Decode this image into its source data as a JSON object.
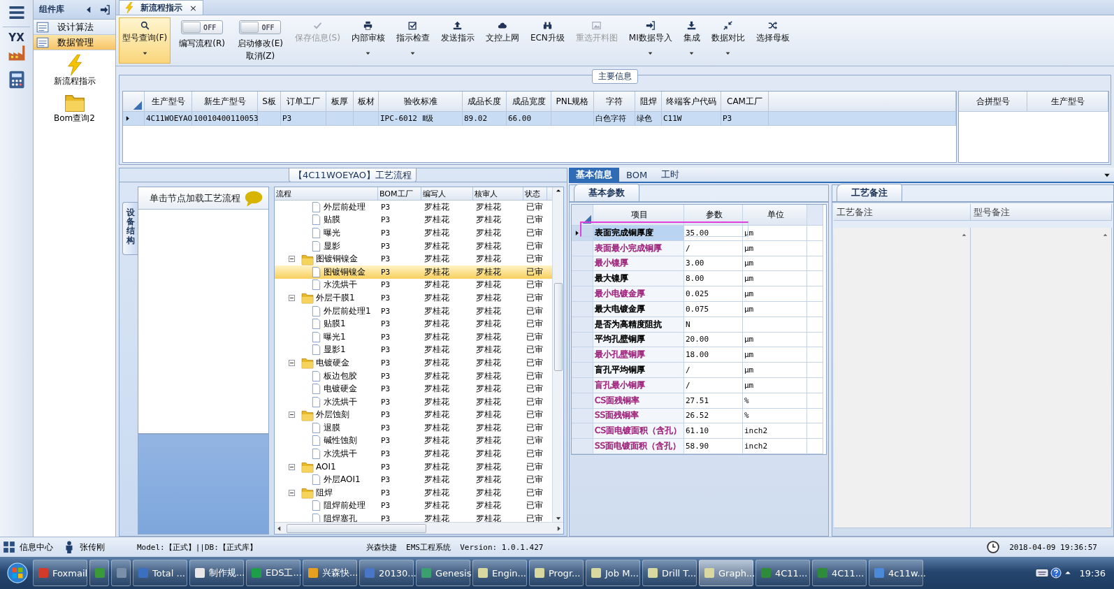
{
  "rail": {
    "items": [
      {
        "kind": "menu"
      },
      {
        "kind": "logo",
        "text": "YX"
      },
      {
        "kind": "calc"
      }
    ]
  },
  "sidebar": {
    "title": "组件库",
    "items": [
      {
        "label": "设计算法",
        "selected": false
      },
      {
        "label": "数据管理",
        "selected": true
      }
    ],
    "shortcuts": [
      {
        "label": "新流程指示"
      },
      {
        "label": "Bom查询2"
      }
    ]
  },
  "document_tabs": [
    {
      "label": "新流程指示",
      "selected": true,
      "close": "×"
    }
  ],
  "toolbar": [
    {
      "kind": "button",
      "label": "型号查询(F)",
      "selected": true,
      "disabled": false,
      "dropdown": true
    },
    {
      "kind": "toggle",
      "switch_text": "OFF",
      "on": false,
      "label": "编写流程(R)"
    },
    {
      "kind": "toggle",
      "switch_text": "OFF",
      "on": false,
      "label": "启动修改(E)",
      "label_2": "取消(Z)"
    },
    {
      "kind": "button",
      "label": "保存信息(S)",
      "selected": false,
      "disabled": true,
      "dropdown": false
    },
    {
      "kind": "button",
      "label": "内部审核",
      "selected": false,
      "disabled": false,
      "dropdown": true
    },
    {
      "kind": "button",
      "label": "指示检查",
      "selected": false,
      "disabled": false,
      "dropdown": true
    },
    {
      "kind": "button",
      "label": "发送指示",
      "selected": false,
      "disabled": false,
      "dropdown": false
    },
    {
      "kind": "button",
      "label": "文控上网",
      "selected": false,
      "disabled": false,
      "dropdown": false
    },
    {
      "kind": "button",
      "label": "ECN升级",
      "selected": false,
      "disabled": false,
      "dropdown": false
    },
    {
      "kind": "button",
      "label": "重选开料图",
      "selected": false,
      "disabled": true,
      "dropdown": false
    },
    {
      "kind": "button",
      "label": "MI数据导入",
      "selected": false,
      "disabled": false,
      "dropdown": true
    },
    {
      "kind": "button",
      "label": "集成",
      "selected": false,
      "disabled": false,
      "dropdown": true
    },
    {
      "kind": "button",
      "label": "数据对比",
      "selected": false,
      "disabled": false,
      "dropdown": true
    },
    {
      "kind": "button",
      "label": "选择母板",
      "selected": false,
      "disabled": false,
      "dropdown": false
    }
  ],
  "main_info": {
    "title": "主要信息",
    "row_selected": true,
    "columns": [
      {
        "label": "生产型号",
        "value": "4C11WOEYAO"
      },
      {
        "label": "新生产型号",
        "value": "10010400110053"
      },
      {
        "label": "S板"
      },
      {
        "label": "订单工厂",
        "value": "P3"
      },
      {
        "label": "板厚"
      },
      {
        "label": "板材"
      },
      {
        "label": "验收标准",
        "value": "IPC-6012 Ⅱ级"
      },
      {
        "label": "成品长度",
        "value": "89.02"
      },
      {
        "label": "成品宽度",
        "value": "66.00"
      },
      {
        "label": "PNL规格"
      },
      {
        "label": "字符",
        "value": "白色字符"
      },
      {
        "label": "阻焊",
        "value": "绿色"
      },
      {
        "label": "终端客户代码",
        "value": "C11W"
      },
      {
        "label": "CAM工厂",
        "value": "P3"
      }
    ],
    "side_columns": [
      "合拼型号",
      "生产型号"
    ]
  },
  "flow": {
    "title": "【4C11WOEYAO】工艺流程",
    "side_tab": "设备结构",
    "hint": "单击节点加载工艺流程",
    "columns": [
      "流程",
      "BOM工厂",
      "编写人",
      "核审人",
      "状态"
    ],
    "continued": [
      {
        "name": "外层前处理",
        "bom_factory": "P3",
        "writer": "罗桂花",
        "reviewer": "罗桂花",
        "status": "已审",
        "selected": false
      },
      {
        "name": "贴膜",
        "bom_factory": "P3",
        "writer": "罗桂花",
        "reviewer": "罗桂花",
        "status": "已审",
        "selected": false
      },
      {
        "name": "曝光",
        "bom_factory": "P3",
        "writer": "罗桂花",
        "reviewer": "罗桂花",
        "status": "已审",
        "selected": false
      },
      {
        "name": "显影",
        "bom_factory": "P3",
        "writer": "罗桂花",
        "reviewer": "罗桂花",
        "status": "已审",
        "selected": false
      }
    ],
    "nodes": [
      {
        "name": "图镀铜镍金",
        "bom_factory": "P3",
        "writer": "罗桂花",
        "reviewer": "罗桂花",
        "status": "已审",
        "selected": false,
        "expanded": true,
        "children": [
          {
            "name": "图镀铜镍金",
            "bom_factory": "P3",
            "writer": "罗桂花",
            "reviewer": "罗桂花",
            "status": "已审",
            "selected": true
          },
          {
            "name": "水洗烘干",
            "bom_factory": "P3",
            "writer": "罗桂花",
            "reviewer": "罗桂花",
            "status": "已审",
            "selected": false
          }
        ]
      },
      {
        "name": "外层干膜1",
        "bom_factory": "P3",
        "writer": "罗桂花",
        "reviewer": "罗桂花",
        "status": "已审",
        "selected": false,
        "expanded": true,
        "children": [
          {
            "name": "外层前处理1",
            "bom_factory": "P3",
            "writer": "罗桂花",
            "reviewer": "罗桂花",
            "status": "已审",
            "selected": false
          },
          {
            "name": "贴膜1",
            "bom_factory": "P3",
            "writer": "罗桂花",
            "reviewer": "罗桂花",
            "status": "已审",
            "selected": false
          },
          {
            "name": "曝光1",
            "bom_factory": "P3",
            "writer": "罗桂花",
            "reviewer": "罗桂花",
            "status": "已审",
            "selected": false
          },
          {
            "name": "显影1",
            "bom_factory": "P3",
            "writer": "罗桂花",
            "reviewer": "罗桂花",
            "status": "已审",
            "selected": false
          }
        ]
      },
      {
        "name": "电镀硬金",
        "bom_factory": "P3",
        "writer": "罗桂花",
        "reviewer": "罗桂花",
        "status": "已审",
        "selected": false,
        "expanded": true,
        "children": [
          {
            "name": "板边包胶",
            "bom_factory": "P3",
            "writer": "罗桂花",
            "reviewer": "罗桂花",
            "status": "已审",
            "selected": false
          },
          {
            "name": "电镀硬金",
            "bom_factory": "P3",
            "writer": "罗桂花",
            "reviewer": "罗桂花",
            "status": "已审",
            "selected": false
          },
          {
            "name": "水洗烘干",
            "bom_factory": "P3",
            "writer": "罗桂花",
            "reviewer": "罗桂花",
            "status": "已审",
            "selected": false
          }
        ]
      },
      {
        "name": "外层蚀刻",
        "bom_factory": "P3",
        "writer": "罗桂花",
        "reviewer": "罗桂花",
        "status": "已审",
        "selected": false,
        "expanded": true,
        "children": [
          {
            "name": "退膜",
            "bom_factory": "P3",
            "writer": "罗桂花",
            "reviewer": "罗桂花",
            "status": "已审",
            "selected": false
          },
          {
            "name": "碱性蚀刻",
            "bom_factory": "P3",
            "writer": "罗桂花",
            "reviewer": "罗桂花",
            "status": "已审",
            "selected": false
          },
          {
            "name": "水洗烘干",
            "bom_factory": "P3",
            "writer": "罗桂花",
            "reviewer": "罗桂花",
            "status": "已审",
            "selected": false
          }
        ]
      },
      {
        "name": "AOI1",
        "bom_factory": "P3",
        "writer": "罗桂花",
        "reviewer": "罗桂花",
        "status": "已审",
        "selected": false,
        "expanded": true,
        "children": [
          {
            "name": "外层AOI1",
            "bom_factory": "P3",
            "writer": "罗桂花",
            "reviewer": "罗桂花",
            "status": "已审",
            "selected": false
          }
        ]
      },
      {
        "name": "阻焊",
        "bom_factory": "P3",
        "writer": "罗桂花",
        "reviewer": "罗桂花",
        "status": "已审",
        "selected": false,
        "expanded": true,
        "children": [
          {
            "name": "阻焊前处理",
            "bom_factory": "P3",
            "writer": "罗桂花",
            "reviewer": "罗桂花",
            "status": "已审",
            "selected": false
          },
          {
            "name": "阻焊塞孔",
            "bom_factory": "P3",
            "writer": "罗桂花",
            "reviewer": "罗桂花",
            "status": "已审",
            "selected": false
          }
        ]
      }
    ]
  },
  "detail": {
    "tabs": [
      {
        "label": "基本信息",
        "selected": true
      },
      {
        "label": "BOM",
        "selected": false
      },
      {
        "label": "工时",
        "selected": false
      }
    ],
    "params": {
      "tab": "基本参数",
      "columns": [
        "项目",
        "参数",
        "单位"
      ],
      "highlight": true,
      "rows": [
        {
          "item": "表面完成铜厚度",
          "value": "35.00",
          "unit": "μm",
          "color": "#000000",
          "selected": true
        },
        {
          "item": "表面最小完成铜厚",
          "value": "/",
          "unit": "μm",
          "color": "#a0267e",
          "selected": false
        },
        {
          "item": "最小镍厚",
          "value": "3.00",
          "unit": "μm",
          "color": "#a0267e",
          "selected": false
        },
        {
          "item": "最大镍厚",
          "value": "8.00",
          "unit": "μm",
          "color": "#000000",
          "selected": false
        },
        {
          "item": "最小电镀金厚",
          "value": "0.025",
          "unit": "μm",
          "color": "#a0267e",
          "selected": false
        },
        {
          "item": "最大电镀金厚",
          "value": "0.075",
          "unit": "μm",
          "color": "#000000",
          "selected": false
        },
        {
          "item": "是否为高精度阻抗",
          "value": "N",
          "color": "#000000",
          "selected": false
        },
        {
          "item": "平均孔壁铜厚",
          "value": "20.00",
          "unit": "μm",
          "color": "#000000",
          "selected": false
        },
        {
          "item": "最小孔壁铜厚",
          "value": "18.00",
          "unit": "μm",
          "color": "#a0267e",
          "selected": false
        },
        {
          "item": "盲孔平均铜厚",
          "value": "/",
          "unit": "μm",
          "color": "#000000",
          "selected": false
        },
        {
          "item": "盲孔最小铜厚",
          "value": "/",
          "unit": "μm",
          "color": "#a0267e",
          "selected": false
        },
        {
          "item": "CS面残铜率",
          "value": "27.51",
          "unit": "%",
          "color": "#a0267e",
          "selected": false
        },
        {
          "item": "SS面残铜率",
          "value": "26.52",
          "unit": "%",
          "color": "#a0267e",
          "selected": false
        },
        {
          "item": "CS面电镀面积（含孔）",
          "value": "61.10",
          "unit": "inch2",
          "color": "#a0267e",
          "selected": false
        },
        {
          "item": "SS面电镀面积（含孔）",
          "value": "58.90",
          "unit": "inch2",
          "color": "#a0267e",
          "selected": false
        }
      ]
    },
    "notes": {
      "tab": "工艺备注",
      "columns": [
        "工艺备注",
        "型号备注"
      ]
    }
  },
  "status_bar": {
    "info_center": "信息中心",
    "user": "张传刚",
    "model": "Model:【正式】||DB:【正式库】",
    "system": "兴森快捷  EMS工程系统  Version: 1.0.1.427",
    "datetime": "2018-04-09 19:36:57"
  },
  "taskbar": {
    "items": [
      {
        "label": "Foxmail",
        "selected": false
      },
      {
        "selected": false
      },
      {
        "selected": false
      },
      {
        "label": "Total ...",
        "selected": false
      },
      {
        "label": "制作规...",
        "selected": false
      },
      {
        "label": "EDS工...",
        "selected": false
      },
      {
        "label": "兴森快...",
        "selected": false
      },
      {
        "label": "20130...",
        "selected": false
      },
      {
        "label": "Genesis",
        "selected": false
      },
      {
        "label": "Engin...",
        "selected": false
      },
      {
        "label": "Progr...",
        "selected": false
      },
      {
        "label": "Job M...",
        "selected": false
      },
      {
        "label": "Drill T...",
        "selected": false
      },
      {
        "label": "Graph...",
        "selected": true
      },
      {
        "label": "4C11...",
        "selected": false
      },
      {
        "label": "4C11...",
        "selected": false
      },
      {
        "label": "4c11w...",
        "selected": false
      }
    ],
    "clock": "19:36"
  }
}
